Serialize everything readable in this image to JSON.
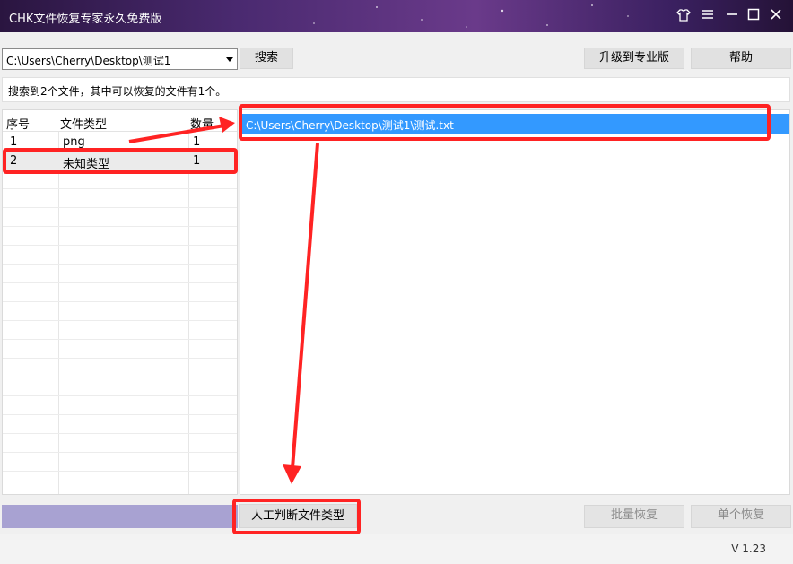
{
  "window": {
    "title": "CHK文件恢复专家永久免费版",
    "controls": [
      "skin-icon",
      "menu-icon",
      "minimize-icon",
      "maximize-icon",
      "close-icon"
    ]
  },
  "toolbar": {
    "path_value": "C:\\Users\\Cherry\\Desktop\\测试1",
    "search_label": "搜索",
    "upgrade_label": "升级到专业版",
    "help_label": "帮助"
  },
  "status_text": "搜索到2个文件，其中可以恢复的文件有1个。",
  "file_types": {
    "columns": [
      "序号",
      "文件类型",
      "数量"
    ],
    "rows": [
      {
        "index": "1",
        "type": "png",
        "count": "1"
      },
      {
        "index": "2",
        "type": "未知类型",
        "count": "1"
      }
    ]
  },
  "file_list": {
    "items": [
      "C:\\Users\\Cherry\\Desktop\\测试1\\测试.txt"
    ]
  },
  "actions": {
    "manual_type_label": "人工判断文件类型",
    "batch_restore_label": "批量恢复",
    "single_restore_label": "单个恢复"
  },
  "version": "V 1.23",
  "colors": {
    "annotation": "#ff2323",
    "selection": "#3399ff",
    "progress": "#a8a2d2"
  }
}
